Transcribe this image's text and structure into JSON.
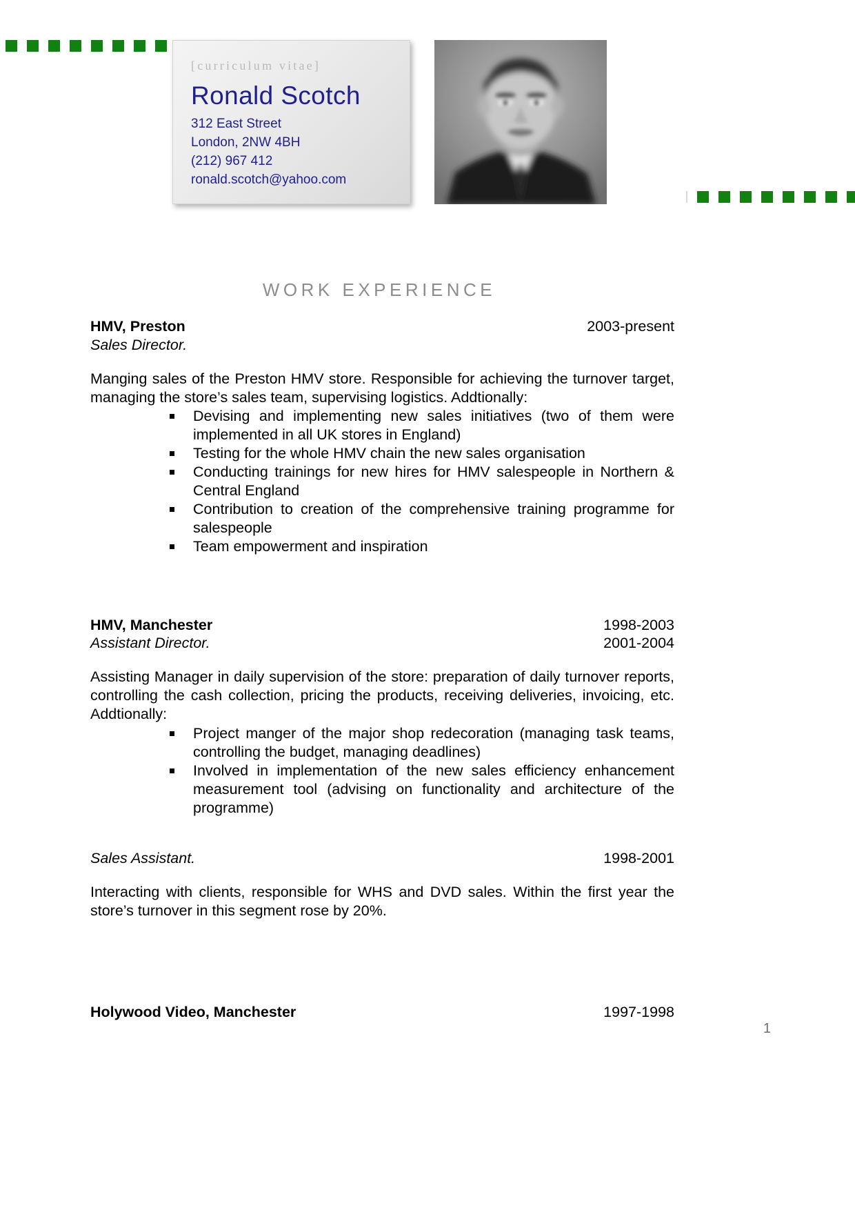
{
  "decor": {
    "green_hex": "#118111",
    "top_left_dot_count": 10,
    "right_dot_count": 10
  },
  "header": {
    "cv_label": "[curriculum vitae]",
    "name": "Ronald Scotch",
    "address_line1": "312 East Street",
    "address_line2": "London, 2NW 4BH",
    "phone": "(212) 967 412",
    "email": "ronald.scotch@yahoo.com",
    "name_color": "#1f1f8f",
    "label_color": "#b9b9b9",
    "photo_alt": "portrait-photo"
  },
  "section": {
    "heading": "WORK EXPERIENCE",
    "heading_color": "#8d8d8d"
  },
  "jobs": [
    {
      "company": "HMV, Preston",
      "dates": "2003-present",
      "title": "Sales Director.",
      "title_dates": "",
      "paragraph": "Manging sales of the Preston HMV store. Responsible for achieving the turnover target, managing the store’s sales team, supervising logistics. Addtionally:",
      "bullets": [
        "Devising and implementing new sales initiatives (two of them were implemented in all UK stores in England)",
        "Testing for the whole HMV chain the new sales organisation",
        "Conducting trainings for new hires for HMV salespeople in Northern & Central England",
        "Contribution to creation of the comprehensive training programme for salespeople",
        "Team empowerment and inspiration"
      ]
    },
    {
      "company": "HMV, Manchester",
      "dates": "1998-2003",
      "title": "Assistant Director.",
      "title_dates": "2001-2004",
      "paragraph": "Assisting Manager in daily supervision of the store: preparation of daily turnover reports, controlling the cash collection, pricing the products, receiving deliveries, invoicing, etc. Addtionally:",
      "bullets": [
        "Project manger of the major shop redecoration (managing task teams, controlling the budget, managing deadlines)",
        "Involved in implementation of the new sales efficiency enhancement measurement tool (advising on functionality and architecture of the programme)"
      ]
    }
  ],
  "subrole": {
    "title": "Sales Assistant.",
    "dates": "1998-2001",
    "paragraph": "Interacting with clients, responsible for WHS and DVD sales. Within the first year the store’s turnover in this segment rose by 20%."
  },
  "last_job": {
    "company": "Holywood Video, Manchester",
    "dates": "1997-1998"
  },
  "footer": {
    "page_number": "1"
  }
}
